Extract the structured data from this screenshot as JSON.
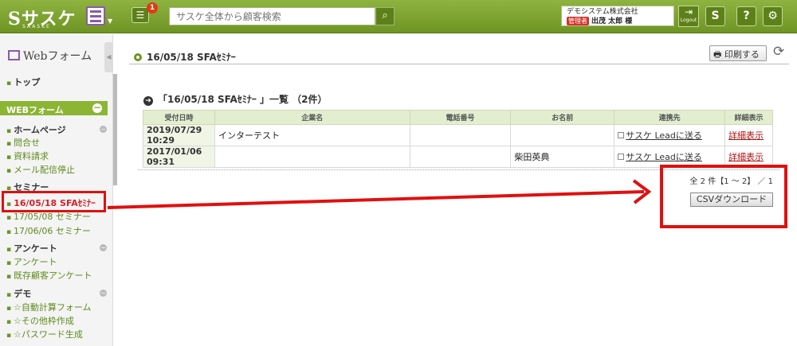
{
  "header": {
    "logo": "Sサスケ",
    "logo_sub": "SAASKE",
    "notify_count": "1",
    "search_placeholder": "サスケ全体から顧客検索",
    "company": "デモシステム株式会社",
    "role": "管理者",
    "user": "出茂 太郎 様",
    "logout": "Logout"
  },
  "sidebar": {
    "title": "Webフォーム",
    "top": "トップ",
    "section": "WEBフォーム",
    "groups": [
      {
        "label": "ホームページ",
        "items": [
          "問合せ",
          "資料請求",
          "メール配信停止"
        ]
      },
      {
        "label": "セミナー",
        "items": [
          "16/05/18 SFAｾﾐﾅｰ",
          "17/05/08 セミナー",
          "17/06/06 セミナー"
        ]
      },
      {
        "label": "アンケート",
        "items": [
          "アンケート",
          "既存顧客アンケート"
        ]
      },
      {
        "label": "デモ",
        "items": [
          "☆自動計算フォーム",
          "☆その他枠作成",
          "☆パスワード生成"
        ]
      }
    ]
  },
  "main": {
    "title": "16/05/18 SFAｾﾐﾅｰ",
    "print_label": "印刷する",
    "list_title": "「16/05/18 SFAｾﾐﾅｰ 」一覧 （2件）",
    "columns": [
      "受付日時",
      "企業名",
      "電話番号",
      "お名前",
      "連携先",
      "詳細表示"
    ],
    "rows": [
      {
        "date": "2019/07/29 10:29",
        "company": "インターテスト",
        "phone": "",
        "name": "",
        "link": "サスケ Leadに送る",
        "detail": "詳細表示"
      },
      {
        "date": "2017/01/06 09:31",
        "company": "",
        "phone": "",
        "name": "柴田英典",
        "link": "サスケ Leadに送る",
        "detail": "詳細表示"
      }
    ],
    "pager": "全 2 件【1 ～ 2】 ／ 1",
    "csv_label": "CSVダウンロード"
  },
  "colors": {
    "accent": "#6e9424",
    "annotation": "#e01010"
  }
}
